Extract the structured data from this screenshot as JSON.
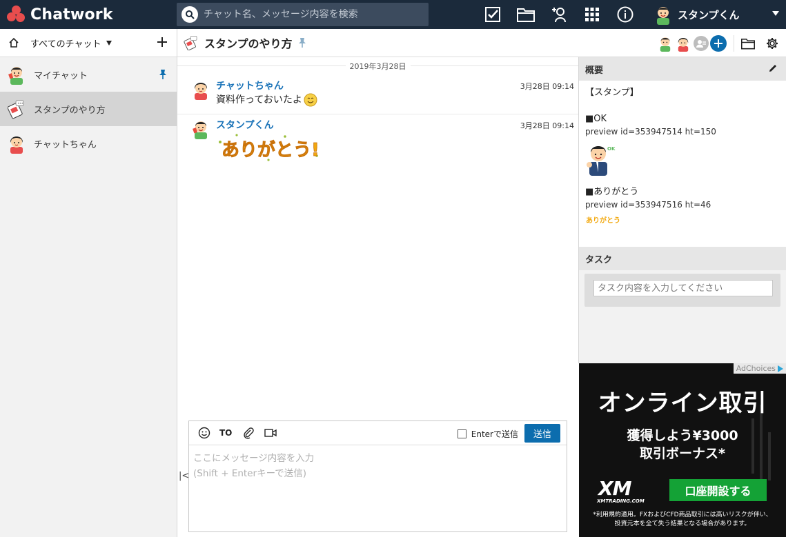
{
  "app": {
    "name": "Chatwork"
  },
  "search": {
    "placeholder": "チャット名、メッセージ内容を検索"
  },
  "user": {
    "name": "スタンプくん"
  },
  "sidebar": {
    "filter_label": "すべてのチャット",
    "rooms": [
      {
        "name": "マイチャット",
        "pinned": true
      },
      {
        "name": "スタンプのやり方",
        "active": true
      },
      {
        "name": "チャットちゃん"
      }
    ]
  },
  "room": {
    "title": "スタンプのやり方"
  },
  "timeline": {
    "date": "2019年3月28日",
    "messages": [
      {
        "sender": "チャットちゃん",
        "time": "3月28日 09:14",
        "text": "資料作っておいたよ"
      },
      {
        "sender": "スタンプくん",
        "time": "3月28日 09:14",
        "stamp_text": "ありがとう!"
      }
    ]
  },
  "composer": {
    "to_label": "TO",
    "enter_send_label": "Enterで送信",
    "send_label": "送信",
    "placeholder": "ここにメッセージ内容を入力\n(Shift + Enterキーで送信)"
  },
  "overview": {
    "heading": "概要",
    "line1": "【スタンプ】",
    "line2": "■OK",
    "line3": "preview id=353947514 ht=150",
    "line4": "■ありがとう",
    "line5": "preview id=353947516 ht=46",
    "small_stamp_text": "ありがとう!"
  },
  "task": {
    "heading": "タスク",
    "placeholder": "タスク内容を入力してください"
  },
  "ad": {
    "choices": "AdChoices",
    "headline": "オンライン取引",
    "sub1": "獲得しよう¥3000",
    "sub2": "取引ボーナス*",
    "logo": "XM",
    "logo_sub": "XMTRADING.COM",
    "cta": "口座開設する",
    "note1": "*利用規約適用。FXおよびCFD商品取引には高いリスクが伴い、",
    "note2": "投資元本を全て失う結果となる場合があります。"
  },
  "colors": {
    "topbar": "#1b2a3b",
    "accent": "#0c6dae",
    "logo": "#e84d4d",
    "sender": "#1a73b8",
    "ad_cta": "#14a236"
  }
}
